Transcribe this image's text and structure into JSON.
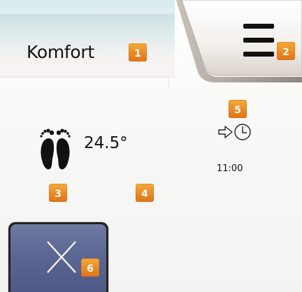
{
  "header": {
    "mode_label": "Komfort"
  },
  "comfort": {
    "temperature": "24.5°",
    "next_change_time": "11:00"
  },
  "badges": {
    "b1": "1",
    "b2": "2",
    "b3": "3",
    "b4": "4",
    "b5": "5",
    "b6": "6"
  },
  "icons": {
    "menu": "hamburger-menu-icon",
    "comfort": "feet-icon",
    "schedule": "arrow-clock-icon",
    "cancel": "close-icon"
  },
  "colors": {
    "badge": "#eb8a24",
    "cancel_button": "#5c6794",
    "header_band": "#d9ebed"
  }
}
